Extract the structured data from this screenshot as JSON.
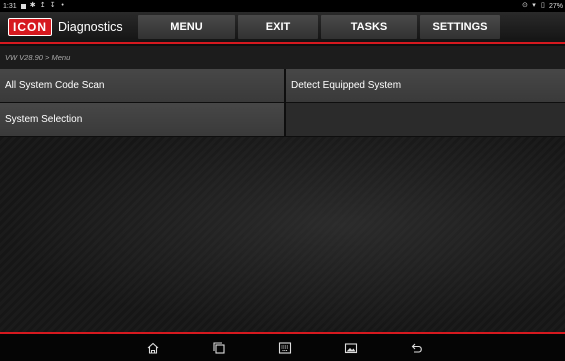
{
  "status_bar": {
    "time": "1:31",
    "battery": "27%",
    "icons": [
      "notification-icon",
      "gear-icon",
      "download-icon",
      "download-icon",
      "dot-icon",
      "location-icon",
      "wifi-icon",
      "battery-icon"
    ]
  },
  "header": {
    "logo_text": "ICON",
    "app_title": "Diagnostics",
    "nav": [
      {
        "label": "MENU"
      },
      {
        "label": "EXIT"
      },
      {
        "label": "TASKS"
      },
      {
        "label": "SETTINGS"
      }
    ]
  },
  "breadcrumb": "VW V28.90 > Menu",
  "menu": {
    "rows": [
      {
        "left": "All System Code Scan",
        "right": "Detect Equipped System"
      },
      {
        "left": "System Selection",
        "right": ""
      }
    ]
  },
  "bottom_nav": [
    "home-icon",
    "recents-icon",
    "keyboard-icon",
    "gallery-icon",
    "back-icon"
  ],
  "colors": {
    "accent": "#d6191f",
    "button": "#3e3e3e",
    "background": "#141414"
  }
}
